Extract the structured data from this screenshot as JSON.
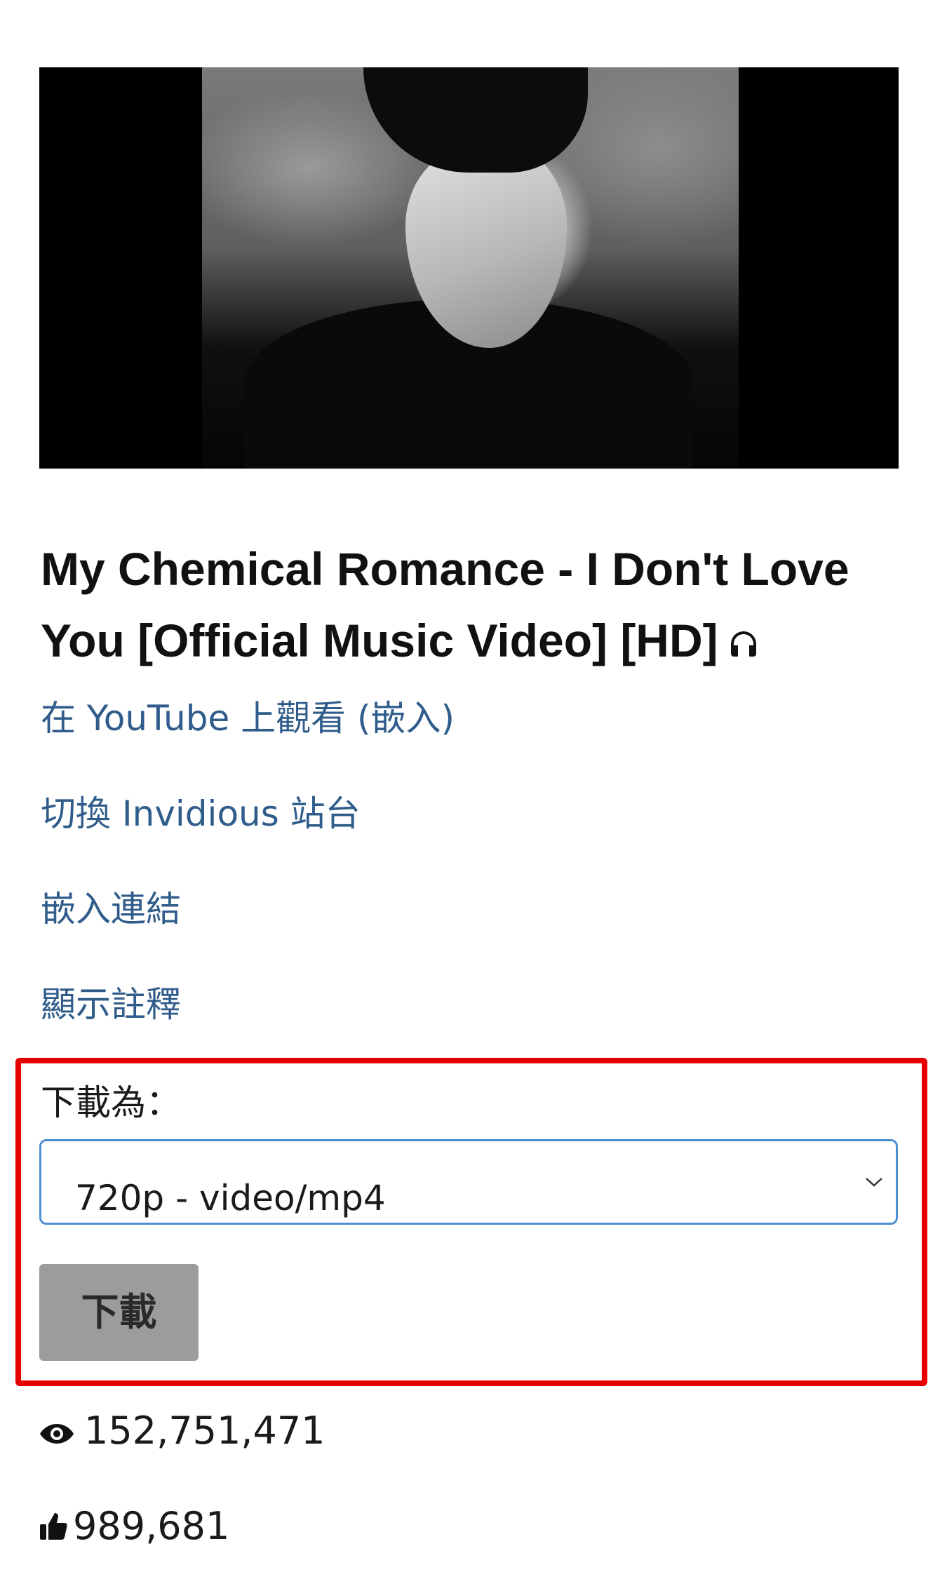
{
  "video": {
    "title": "My Chemical Romance - I Don't Love You [Official Music Video] [HD]",
    "title_icon": "headphones-icon"
  },
  "links": {
    "watch_on_youtube": "在 YouTube 上觀看 (嵌入)",
    "switch_instance": "切換 Invidious 站台",
    "embed_link": "嵌入連結",
    "show_annotations": "顯示註釋"
  },
  "download": {
    "label": "下載為：",
    "selected_format": "720p - video/mp4",
    "button_label": "下載",
    "highlight_color": "#e60000"
  },
  "stats": {
    "views": "152,751,471",
    "views_icon": "eye-icon",
    "likes": "989,681",
    "likes_icon": "thumbs-up-icon"
  },
  "colors": {
    "link": "#2f5c8a",
    "select_border": "#4d8fd0",
    "button_bg": "#9c9c9c"
  }
}
